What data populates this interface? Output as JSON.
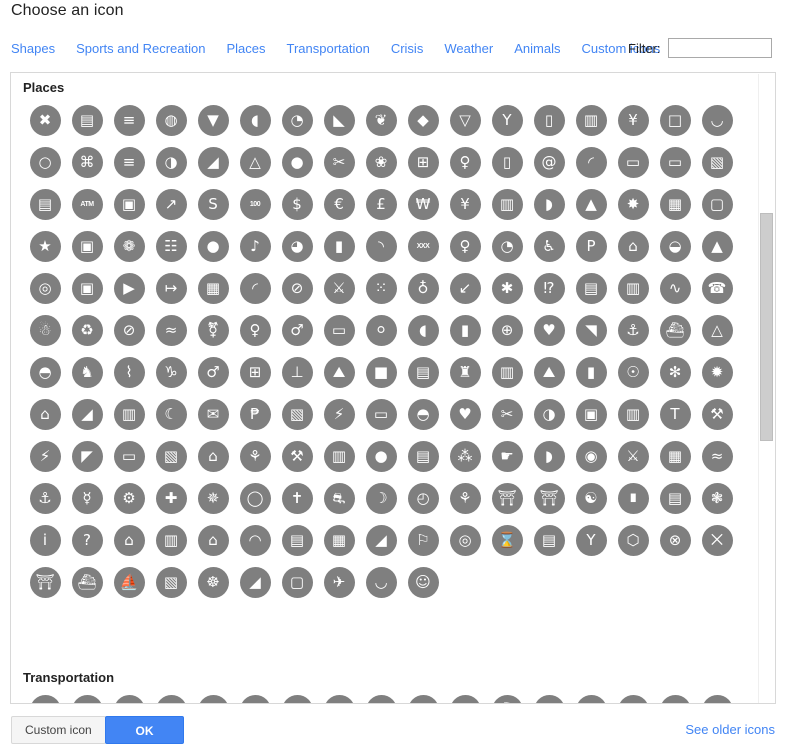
{
  "dialog": {
    "title": "Choose an icon"
  },
  "categories": [
    {
      "label": "Shapes",
      "name": "category-shapes"
    },
    {
      "label": "Sports and Recreation",
      "name": "category-sports-and-recreation"
    },
    {
      "label": "Places",
      "name": "category-places"
    },
    {
      "label": "Transportation",
      "name": "category-transportation"
    },
    {
      "label": "Crisis",
      "name": "category-crisis"
    },
    {
      "label": "Weather",
      "name": "category-weather"
    },
    {
      "label": "Animals",
      "name": "category-animals"
    },
    {
      "label": "Custom icons",
      "name": "category-custom-icons"
    }
  ],
  "filter": {
    "label": "Filter:",
    "value": "",
    "placeholder": ""
  },
  "groups": [
    {
      "title": "Places",
      "columns": 17,
      "icons": [
        "restaurant-icon",
        "fast-food-icon",
        "burger-icon",
        "bakery-icon",
        "ice-cream-icon",
        "noodles-icon",
        "cafe-icon",
        "meat-icon",
        "poultry-icon",
        "seafood-icon",
        "frozen-yogurt-icon",
        "cocktail-icon",
        "takeaway-cup-icon",
        "beer-mug-icon",
        "wine-glass-icon",
        "coffee-cup-icon",
        "teapot-icon",
        "handbag-icon",
        "gift-shop-icon",
        "shopping-cart-icon",
        "clothing-icon",
        "shoe-store-icon",
        "hanger-icon",
        "perfume-icon",
        "barber-icon",
        "florist-icon",
        "supermarket-icon",
        "pharmacy-person-icon",
        "mobile-phone-icon",
        "internet-cafe-icon",
        "wifi-icon",
        "laptop-icon",
        "television-icon",
        "book-store-icon",
        "bank-icon",
        "atm-icon",
        "money-icon",
        "stock-chart-icon",
        "currency-exchange-icon",
        "banknote-icon",
        "dollar-icon",
        "euro-icon",
        "pound-icon",
        "won-icon",
        "yen-icon",
        "vending-machine-icon",
        "balloon-icon",
        "birthday-cake-icon",
        "fireworks-icon",
        "film-strip-icon",
        "picture-frame-icon",
        "ticket-icon",
        "photo-booth-icon",
        "casino-icon",
        "piano-icon",
        "paw-print-icon",
        "music-note-icon",
        "theater-mask-icon",
        "microphone-icon",
        "mustache-icon",
        "adult-only-icon",
        "walking-icon",
        "art-palette-icon",
        "wheelchair-icon",
        "parking-icon",
        "picnic-table-icon",
        "drum-icon",
        "bell-icon",
        "binoculars-icon",
        "camera-icon",
        "video-camera-icon",
        "entrance-icon",
        "calendar-icon",
        "paperclip-icon",
        "no-entry-icon",
        "crossed-wrenches-icon",
        "footprints-icon",
        "runner-icon",
        "arrow-down-left-icon",
        "snowflake-icon",
        "information-desk-icon",
        "scanner-icon",
        "printer-icon",
        "swimmer-icon",
        "telephone-icon",
        "litter-bin-icon",
        "recycling-icon",
        "no-smoking-icon",
        "smoking-icon",
        "restrooms-icon",
        "womens-room-icon",
        "mens-room-icon",
        "baby-changing-icon",
        "nursing-room-icon",
        "stroller-icon",
        "fire-extinguisher-icon",
        "first-aid-icon",
        "aed-icon",
        "stairs-icon",
        "anchor-icon",
        "ferry-icon",
        "lifeguard-tower-icon",
        "cake-stand-icon",
        "horse-riding-icon",
        "fishing-icon",
        "fountain-icon",
        "statue-icon",
        "playground-icon",
        "bench-icon",
        "observation-deck-icon",
        "briefcase-icon",
        "museum-icon",
        "castle-icon",
        "factory-icon",
        "hiking-icon",
        "monument-icon",
        "radio-tower-icon",
        "sunburst-icon",
        "sparkle-icon",
        "home-icon",
        "house-roof-icon",
        "hotel-icon",
        "night-icon",
        "mail-icon",
        "post-office-icon",
        "fuel-station-icon",
        "electric-charging-icon",
        "car-repair-icon",
        "car-wash-icon",
        "heart-icon",
        "scissors-icon",
        "laundry-icon",
        "photo-frame-icon",
        "refrigerator-icon",
        "toll-booth-icon",
        "wrench-icon",
        "power-plug-icon",
        "village-icon",
        "suitcase-icon",
        "open-door-icon",
        "real-estate-icon",
        "park-icon",
        "construction-icon",
        "store-icon",
        "water-drop-icon",
        "courthouse-icon",
        "beekeeping-icon",
        "hand-icon",
        "tooth-icon",
        "eye-icon",
        "x-ray-icon",
        "market-stall-icon",
        "spa-icon",
        "lighthouse-icon",
        "meditation-icon",
        "gear-icon",
        "pharmacy-cross-icon",
        "virus-icon",
        "circle-ring-icon",
        "church-icon",
        "bicycle-icon",
        "crescent-moon-icon",
        "clock-icon",
        "chemistry-icon",
        "temple-icon",
        "torii-gate-icon",
        "yin-yang-icon",
        "bar-chart-icon",
        "library-icon",
        "palm-tree-icon",
        "information-icon",
        "question-mark-icon",
        "home-filled-icon",
        "mailbox-icon",
        "house-outline-icon",
        "bridge-icon",
        "office-building-icon",
        "city-building-icon",
        "mountain-icon",
        "flag-icon",
        "target-icon",
        "hourglass-icon",
        "government-icon",
        "antenna-icon",
        "shield-icon",
        "no-entry-sign-icon",
        "abstract-icon",
        "torii-icon",
        "ship-icon",
        "sailing-icon",
        "package-icon",
        "windmill-icon",
        "ski-jump-icon",
        "robot-icon",
        "rocket-icon",
        "boat-icon",
        "alien-icon"
      ]
    },
    {
      "title": "Transportation",
      "columns": 17,
      "icons": [
        "bus-icon",
        "train-icon",
        "tram-icon",
        "subway-icon",
        "taxi-icon",
        "car-icon",
        "bicycle-transport-icon",
        "motorcycle-icon",
        "truck-icon",
        "airplane-icon",
        "helicopter-icon",
        "ferry-transport-icon",
        "cable-car-icon",
        "scooter-icon",
        "parking-transport-icon",
        "traffic-light-icon",
        "road-icon"
      ]
    }
  ],
  "scrollbar": {
    "position_percent": 22
  },
  "footer": {
    "custom_icon_label": "Custom icon",
    "ok_label": "OK",
    "see_older_label": "See older icons"
  },
  "colors": {
    "link": "#4285f4",
    "primary_button": "#4285f4",
    "icon_circle": "#7f7f7f",
    "panel_border": "#d8d8d8"
  }
}
